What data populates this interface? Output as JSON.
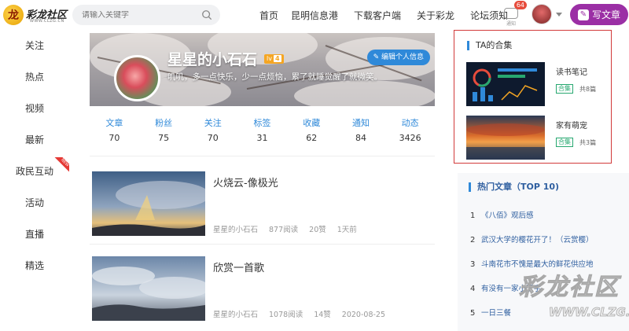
{
  "header": {
    "logo_text": "彩龙社区",
    "logo_sub": "WWW.CLZG.CN",
    "search_placeholder": "请输入关键字",
    "nav": [
      "首页",
      "昆明信息港",
      "下载客户端",
      "关于彩龙",
      "论坛须知"
    ],
    "notify_label": "通知",
    "notify_count": "64",
    "write_label": "写文章"
  },
  "leftnav": {
    "items": [
      "关注",
      "热点",
      "视频",
      "最新",
      "政民互动",
      "活动",
      "直播",
      "精选"
    ],
    "new_badge": "NEW"
  },
  "profile": {
    "name": "星星的小石石",
    "level_prefix": "lv",
    "level": "4",
    "bio": "叽叽，多一点快乐，少一点烦恼，累了就睡觉醒了就微笑。",
    "edit_label": "编辑个人信息",
    "stats": [
      {
        "label": "文章",
        "value": "70"
      },
      {
        "label": "粉丝",
        "value": "75"
      },
      {
        "label": "关注",
        "value": "70"
      },
      {
        "label": "标签",
        "value": "31"
      },
      {
        "label": "收藏",
        "value": "62"
      },
      {
        "label": "通知",
        "value": "84"
      },
      {
        "label": "动态",
        "value": "3426"
      }
    ]
  },
  "posts": [
    {
      "title": "火烧云-像极光",
      "author": "星星的小石石",
      "reads": "877阅读",
      "likes": "20赞",
      "time": "1天前"
    },
    {
      "title": "欣赏一首歌",
      "author": "星星的小石石",
      "reads": "1078阅读",
      "likes": "14赞",
      "time": "2020-08-25"
    }
  ],
  "collection": {
    "heading": "TA的合集",
    "items": [
      {
        "title": "读书笔记",
        "tag": "合集",
        "count": "共8篇"
      },
      {
        "title": "家有萌宠",
        "tag": "合集",
        "count": "共3篇"
      }
    ]
  },
  "hot": {
    "heading": "热门文章（TOP 10)",
    "items": [
      {
        "n": "1",
        "title": "《八佰》观后感"
      },
      {
        "n": "2",
        "title": "武汉大学的樱花开了！（云赏樱）"
      },
      {
        "n": "3",
        "title": "斗南花市不愧是最大的鲜花供应地"
      },
      {
        "n": "4",
        "title": "有没有一家小王宇"
      },
      {
        "n": "5",
        "title": "一日三餐"
      }
    ]
  },
  "watermark": {
    "line1": "彩龙社区",
    "line2": "WWW.CLZG.CN"
  },
  "colors": {
    "accent": "#2f89d9",
    "write_button": "#9b2fa5",
    "highlight_border": "#d23a3a",
    "tag_green": "#27a870"
  }
}
